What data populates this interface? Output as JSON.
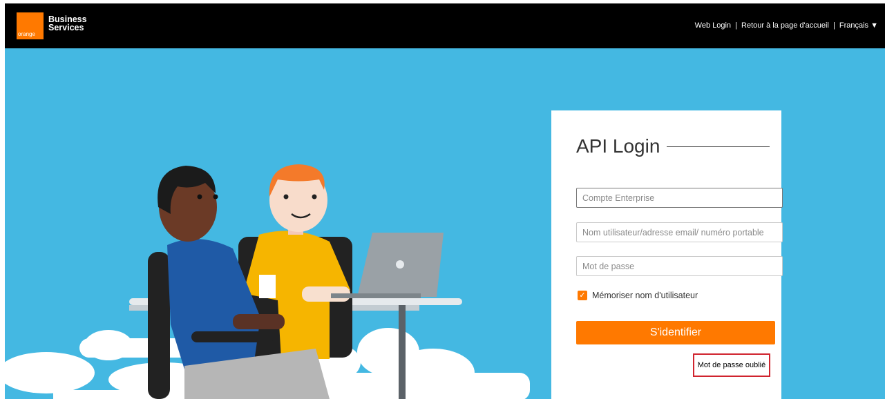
{
  "header": {
    "logo_word": "orange",
    "brand_line1": "Business",
    "brand_line2": "Services",
    "nav": {
      "web_login": "Web Login",
      "separator1": "|",
      "home": "Retour à la page d'accueil",
      "separator2": "|",
      "language": "Français ▼"
    }
  },
  "login": {
    "title": "API Login",
    "company_placeholder": "Compte Enterprise",
    "username_placeholder": "Nom utilisateur/adresse email/ numéro portable",
    "password_placeholder": "Mot de passe",
    "remember_checked": true,
    "remember_label": "Mémoriser nom d'utilisateur",
    "submit_label": "S'identifier",
    "forgot_label": "Mot de passe oublié"
  },
  "colors": {
    "brand_orange": "#ff7900",
    "hero_blue": "#44b8e2",
    "highlight_red": "#d0242e"
  }
}
